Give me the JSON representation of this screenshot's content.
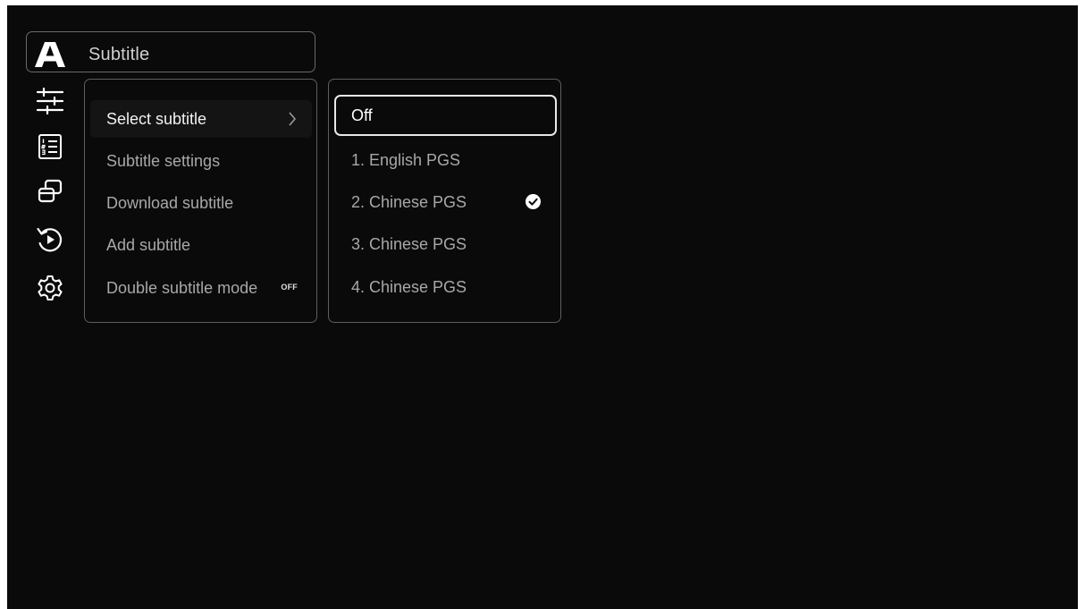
{
  "header": {
    "logo_icon": "brand-a-logo",
    "title": "Subtitle"
  },
  "sidebar": {
    "icons": [
      "sliders-icon",
      "numbered-list-icon",
      "windows-icon",
      "replay-icon",
      "gear-icon"
    ]
  },
  "menu": {
    "items": [
      {
        "label": "Select subtitle",
        "selected": true,
        "has_arrow": true
      },
      {
        "label": "Subtitle settings"
      },
      {
        "label": "Download subtitle"
      },
      {
        "label": "Add subtitle"
      },
      {
        "label": "Double subtitle mode",
        "toggle": "OFF"
      }
    ]
  },
  "options": {
    "items": [
      {
        "label": "Off",
        "focused": true
      },
      {
        "label": "1. English PGS"
      },
      {
        "label": "2. Chinese PGS",
        "checked": true
      },
      {
        "label": "3. Chinese PGS"
      },
      {
        "label": "4. Chinese PGS"
      }
    ]
  },
  "colors": {
    "background": "#0a0a0a",
    "border": "#5e5e5e",
    "text_dim": "#a8a8a8",
    "text_active": "#f2f2f2"
  }
}
